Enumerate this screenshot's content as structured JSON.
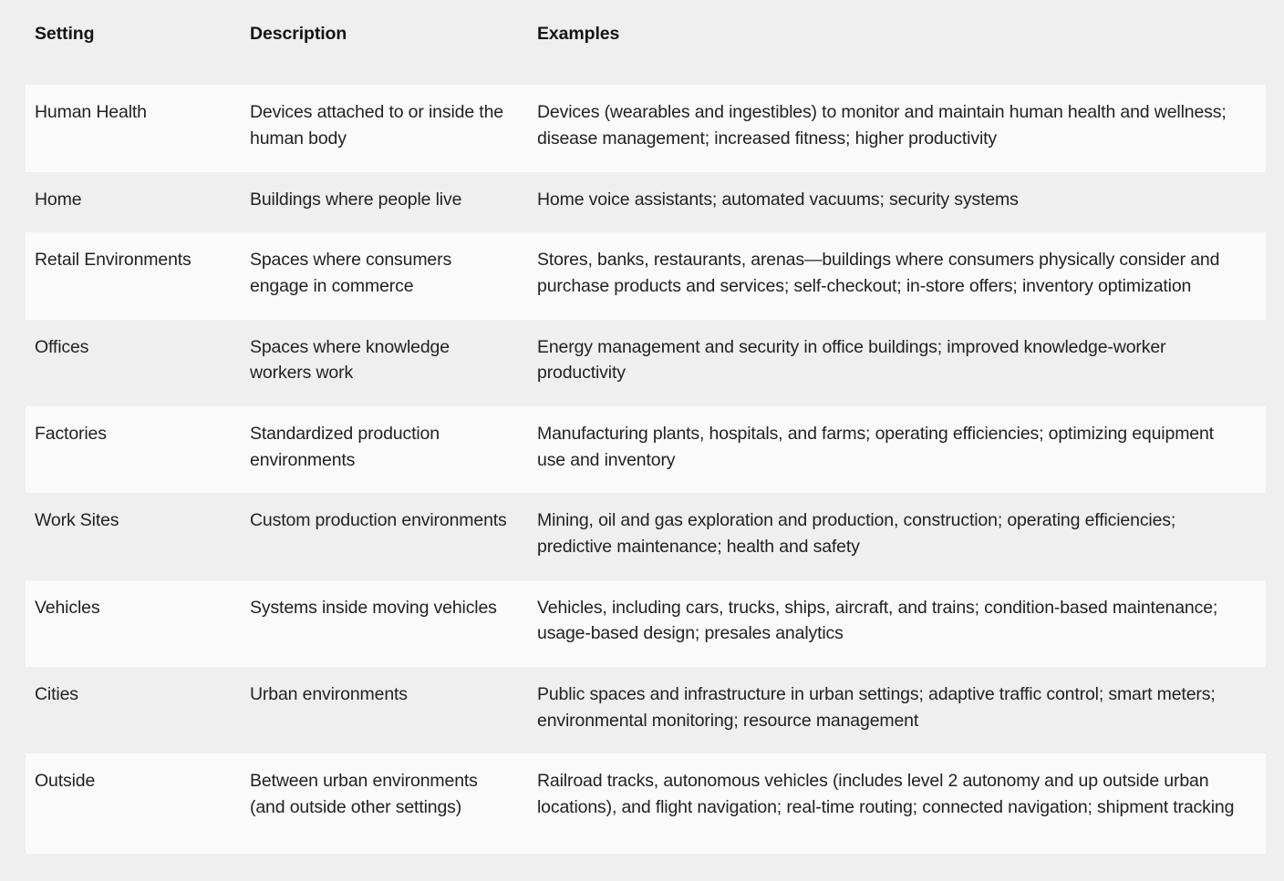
{
  "table": {
    "columns": [
      {
        "key": "setting",
        "label": "Setting"
      },
      {
        "key": "description",
        "label": "Description"
      },
      {
        "key": "examples",
        "label": "Examples"
      }
    ],
    "rows": [
      {
        "setting": "Human Health",
        "description": "Devices attached to or inside the human body",
        "examples": "Devices (wearables and ingestibles) to monitor and maintain human health and wellness; disease management; increased fitness; higher productivity"
      },
      {
        "setting": "Home",
        "description": "Buildings where people live",
        "examples": "Home voice assistants; automated vacuums; security systems"
      },
      {
        "setting": "Retail Environments",
        "description": "Spaces where consumers engage in commerce",
        "examples": "Stores, banks, restaurants, arenas—buildings where consumers physically consider and purchase products and services; self-checkout; in-store offers; inventory optimization"
      },
      {
        "setting": "Offices",
        "description": "Spaces where knowledge workers work",
        "examples": "Energy management and security in office buildings; improved knowledge-worker productivity"
      },
      {
        "setting": "Factories",
        "description": "Standardized production environments",
        "examples": "Manufacturing plants, hospitals, and farms; operating efficiencies; optimizing equipment use and inventory"
      },
      {
        "setting": "Work Sites",
        "description": "Custom production environments",
        "examples": "Mining, oil and gas exploration and production, construction; operating efficiencies; predictive maintenance; health and safety"
      },
      {
        "setting": "Vehicles",
        "description": "Systems inside moving vehicles",
        "examples": "Vehicles, including cars, trucks, ships, aircraft, and trains; condition-based maintenance; usage-based design; presales analytics"
      },
      {
        "setting": "Cities",
        "description": "Urban environments",
        "examples": "Public spaces and infrastructure in urban settings; adaptive traffic control; smart meters; environmental monitoring; resource management"
      },
      {
        "setting": "Outside",
        "description": "Between urban environments (and outside other settings)",
        "examples": "Railroad tracks, autonomous vehicles (includes level 2 autonomy and up outside urban locations), and flight navigation; real-time routing; connected navigation; shipment tracking"
      }
    ]
  },
  "colors": {
    "page_background": "#efefef",
    "row_light": "#fafafa",
    "row_shaded": "#efefef",
    "text": "#222222",
    "header_text": "#141414"
  }
}
